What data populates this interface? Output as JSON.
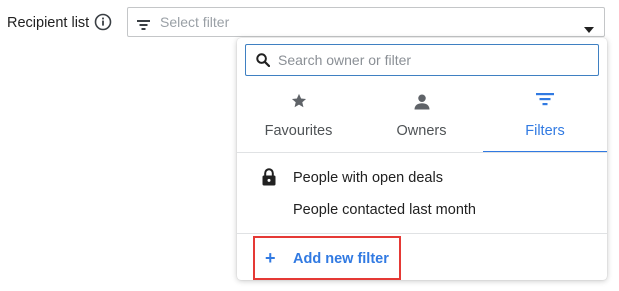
{
  "recipient": {
    "label": "Recipient list",
    "select_placeholder": "Select filter"
  },
  "dropdown": {
    "search_placeholder": "Search owner or filter",
    "tabs": [
      {
        "label": "Favourites",
        "icon": "star-icon",
        "active": false
      },
      {
        "label": "Owners",
        "icon": "person-icon",
        "active": false
      },
      {
        "label": "Filters",
        "icon": "filter-icon",
        "active": true
      }
    ],
    "items": [
      {
        "label": "People with open deals",
        "icon": "lock-icon"
      },
      {
        "label": "People contacted last month",
        "icon": ""
      }
    ],
    "add_filter_label": "Add new filter",
    "add_filter_icon": "+"
  },
  "colors": {
    "accent": "#317ae2",
    "highlight_border": "#e53935"
  }
}
